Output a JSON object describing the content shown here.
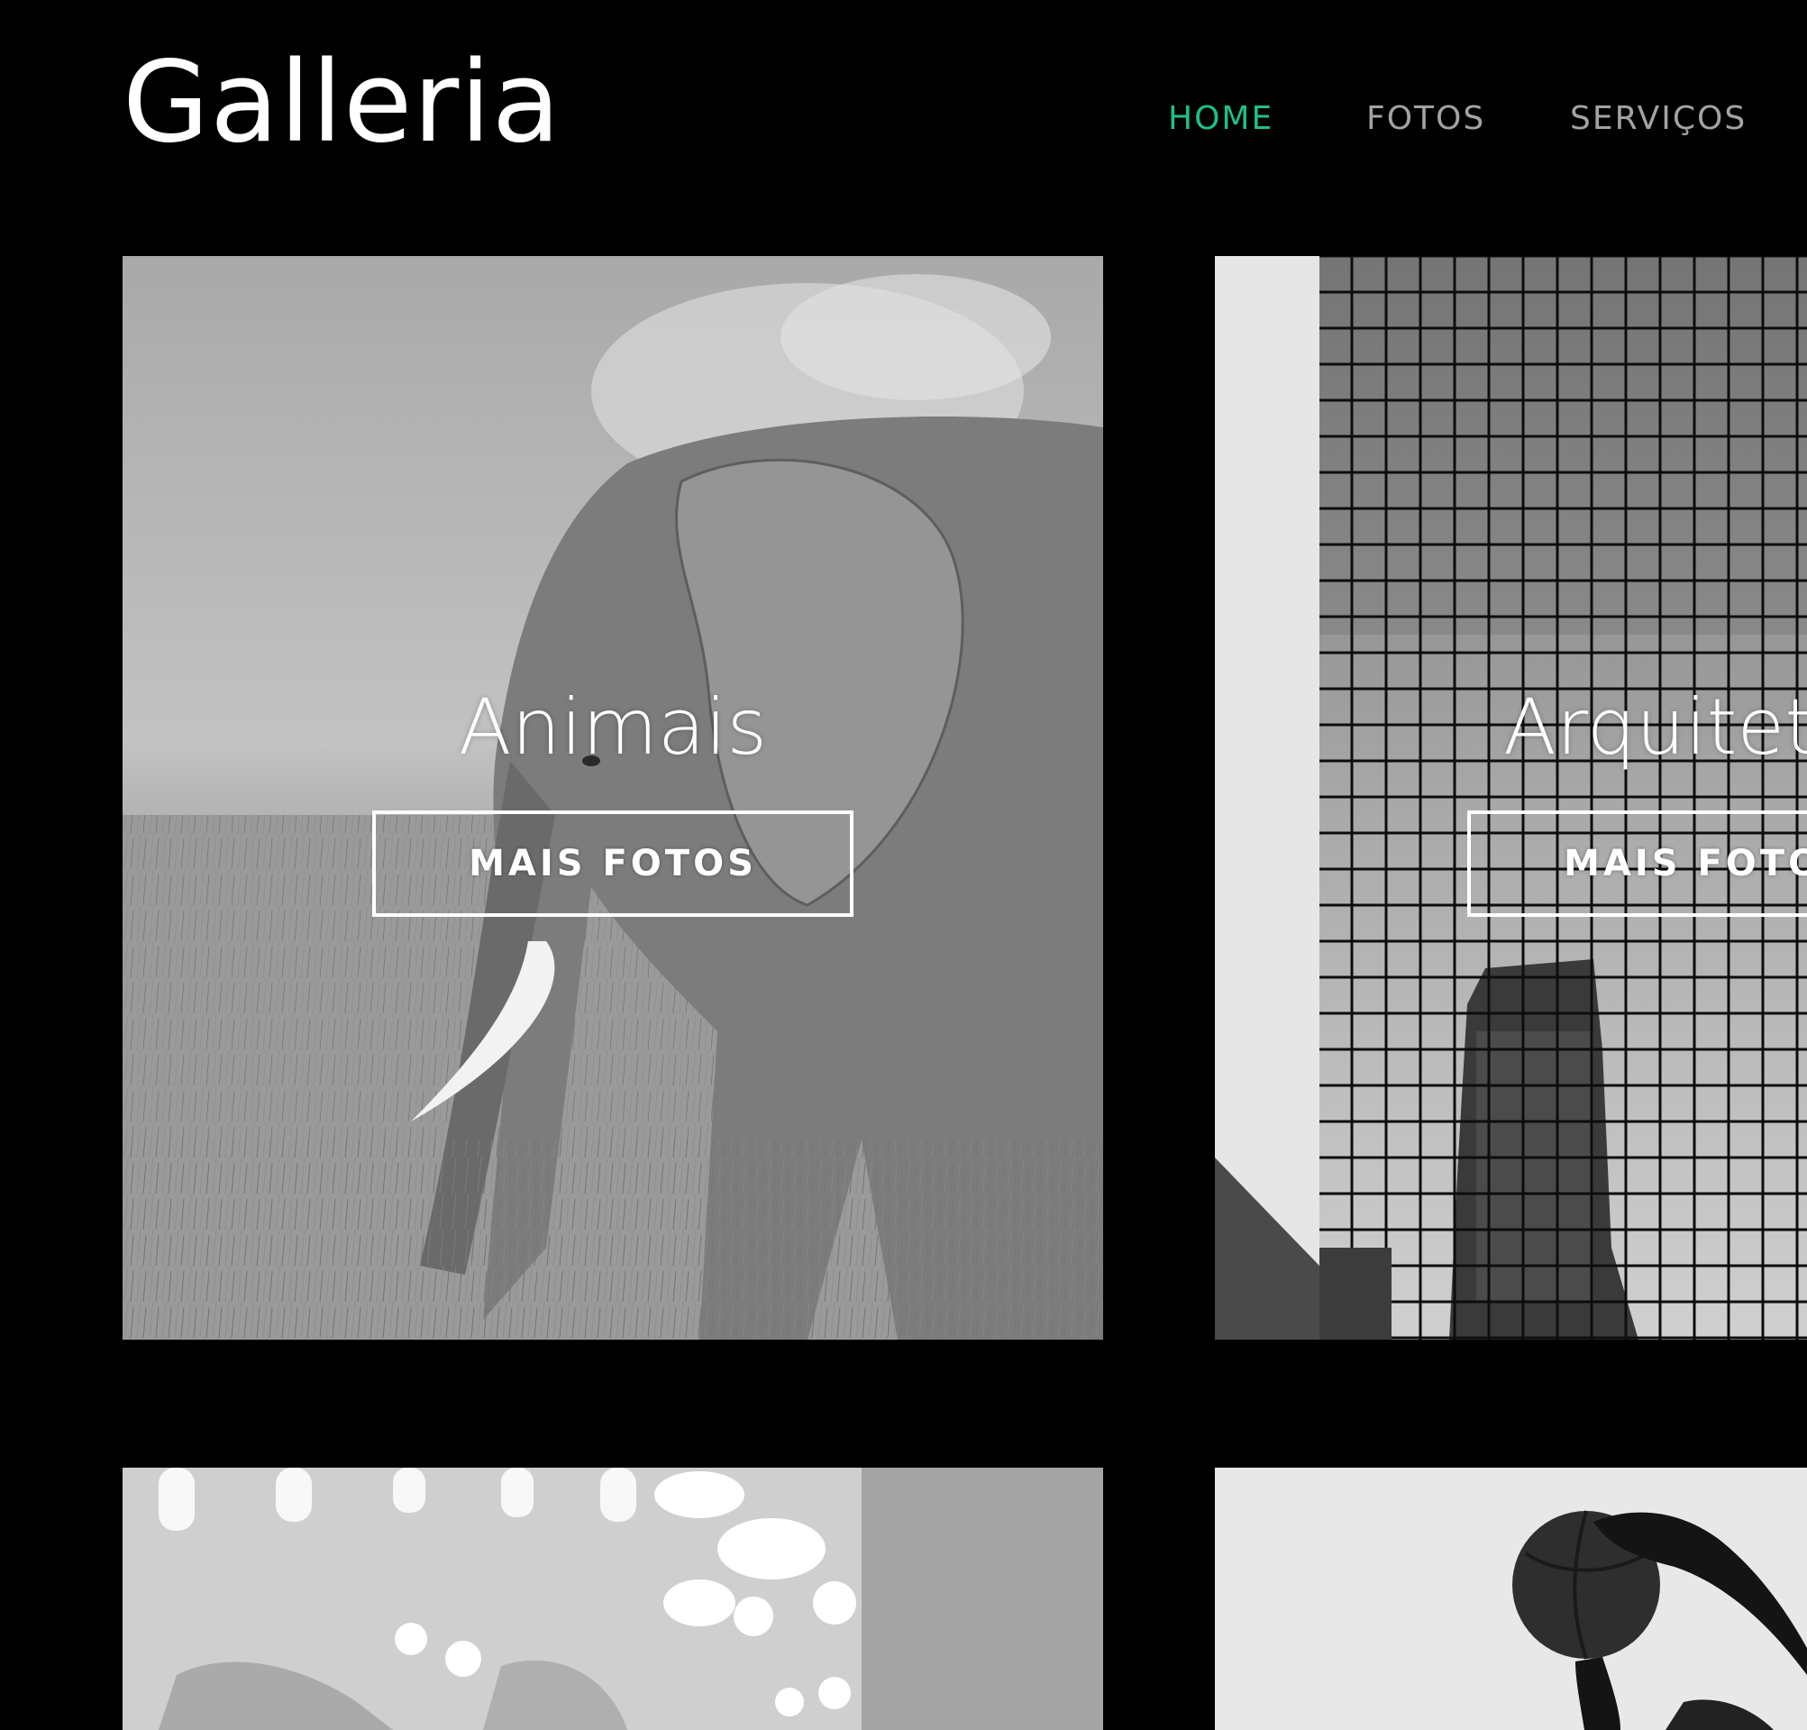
{
  "header": {
    "logo": "Galleria",
    "nav": [
      {
        "label": "HOME",
        "active": true
      },
      {
        "label": "FOTOS",
        "active": false
      },
      {
        "label": "SERVIÇOS",
        "active": false
      }
    ]
  },
  "gallery": {
    "cards": [
      {
        "title": "Animais",
        "button": "MAIS FOTOS",
        "image": "elephant-photo"
      },
      {
        "title": "Arquitetura",
        "button": "MAIS FOTOS",
        "image": "glass-building-photo"
      },
      {
        "title": "",
        "button": "",
        "image": "bokeh-lights-photo"
      },
      {
        "title": "",
        "button": "",
        "image": "basketball-player-photo"
      }
    ]
  },
  "colors": {
    "background": "#000000",
    "accent": "#1fbf8a",
    "nav_inactive": "#a3a3a3",
    "text": "#ffffff"
  }
}
